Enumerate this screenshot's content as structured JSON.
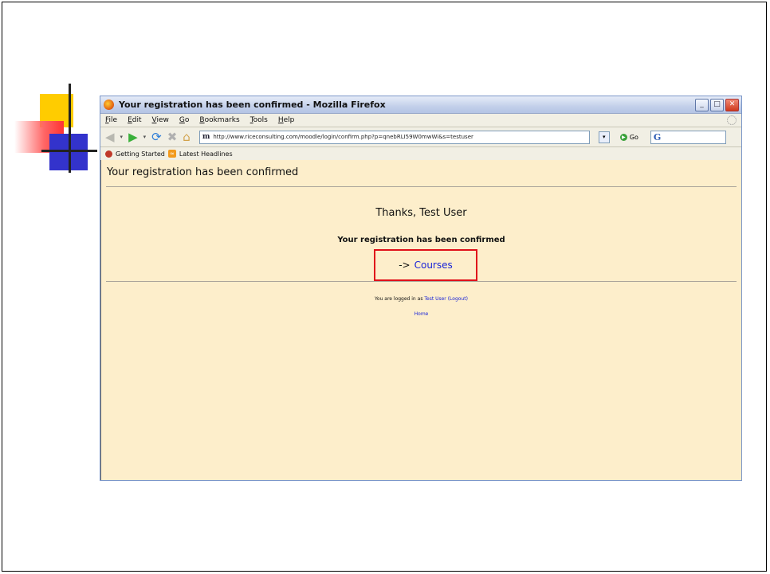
{
  "window": {
    "title": "Your registration has been confirmed - Mozilla Firefox",
    "controls": {
      "minimize": "_",
      "maximize": "□",
      "close": "✕"
    }
  },
  "menu": [
    "File",
    "Edit",
    "View",
    "Go",
    "Bookmarks",
    "Tools",
    "Help"
  ],
  "nav": {
    "url": "http://www.riceconsulting.com/moodle/login/confirm.php?p=qnebRLI59W0mwWi&s=testuser",
    "go_label": "Go",
    "site_icon": "m",
    "search_icon": "G"
  },
  "bookmarks": [
    "Getting Started",
    "Latest Headlines"
  ],
  "page": {
    "title": "Your registration has been confirmed",
    "thanks": "Thanks, Test User",
    "confirmed": "Your registration has been confirmed",
    "courses_arrow": "->",
    "courses_link": "Courses",
    "logged_in_prefix": "You are logged in as",
    "user": "Test User",
    "logout": "(Logout)",
    "home": "Home"
  },
  "colors": {
    "content_bg": "#fdeecb",
    "link": "#1a24d8",
    "highlight_box": "#e0101a"
  }
}
